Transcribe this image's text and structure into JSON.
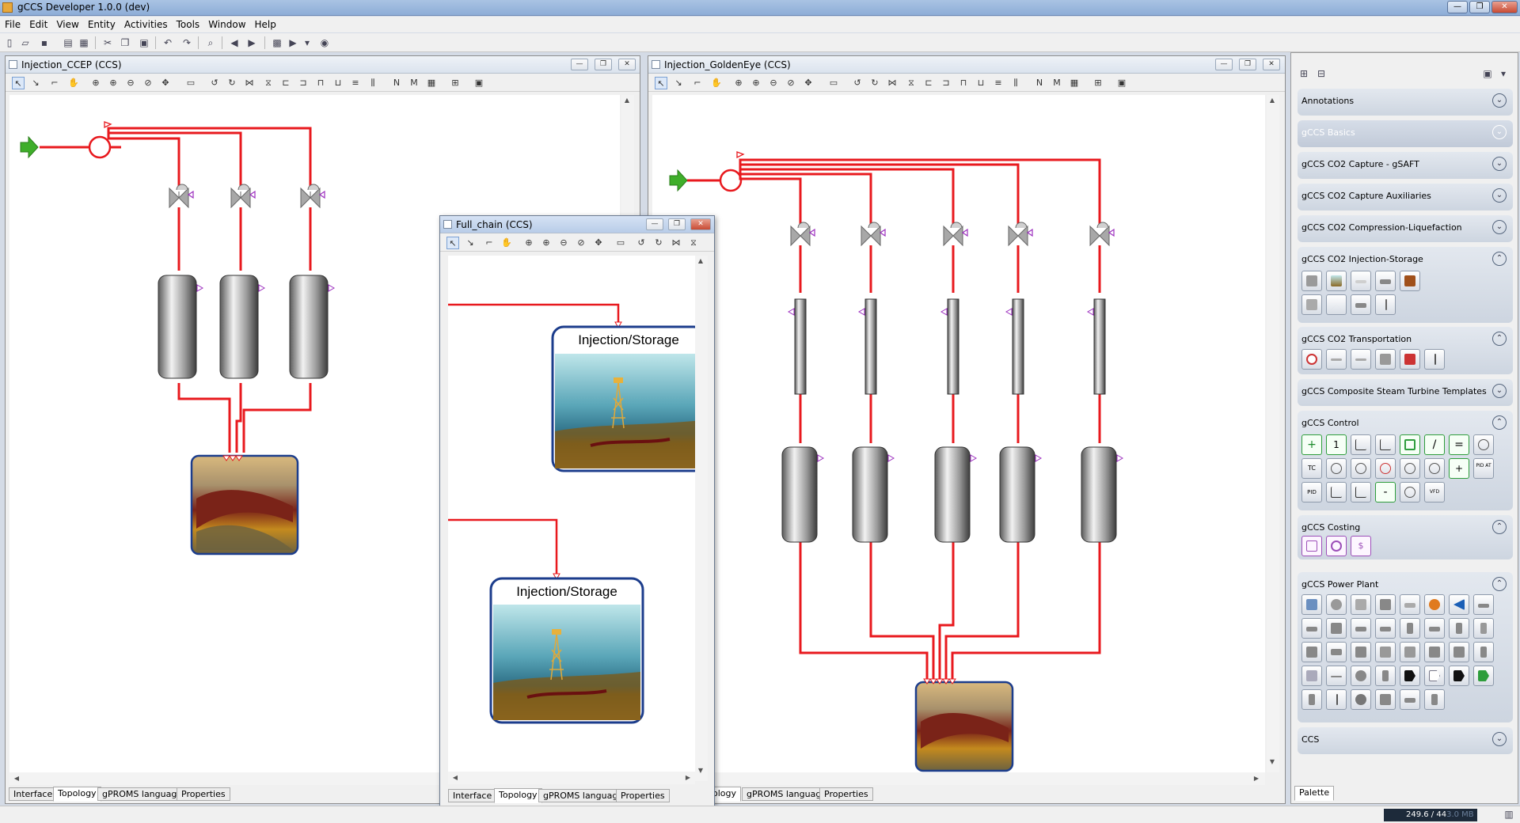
{
  "app": {
    "title": "gCCS Developer 1.0.0 (dev)"
  },
  "menu": [
    "File",
    "Edit",
    "View",
    "Entity",
    "Activities",
    "Tools",
    "Window",
    "Help"
  ],
  "windows": {
    "ccep": {
      "title": "Injection_CCEP  (CCS)"
    },
    "goldeneye": {
      "title": "Injection_GoldenEye  (CCS)"
    },
    "full_chain": {
      "title": "Full_chain  (CCS)"
    }
  },
  "bottom_tabs": [
    "Interface",
    "Topology",
    "gPROMS language",
    "Properties"
  ],
  "goldeneye_tab_partial": "ology",
  "active_tab": "Topology",
  "diagram_labels": {
    "storage_block": "Injection/Storage"
  },
  "palette": {
    "title": "Palette",
    "sections": [
      {
        "label": "Annotations",
        "expanded": false
      },
      {
        "label": "gCCS Basics",
        "expanded": false,
        "faded": true
      },
      {
        "label": "gCCS CO2 Capture - gSAFT",
        "expanded": false
      },
      {
        "label": "gCCS CO2 Capture Auxiliaries",
        "expanded": false
      },
      {
        "label": "gCCS CO2 Compression-Liquefaction",
        "expanded": false
      },
      {
        "label": "gCCS CO2 Injection-Storage",
        "expanded": true
      },
      {
        "label": "gCCS CO2 Transportation",
        "expanded": true
      },
      {
        "label": "gCCS Composite Steam Turbine Templates",
        "expanded": false
      },
      {
        "label": "gCCS Control",
        "expanded": true
      },
      {
        "label": "gCCS Costing",
        "expanded": true
      },
      {
        "label": "gCCS Power Plant",
        "expanded": true
      },
      {
        "label": "CCS",
        "expanded": false
      }
    ],
    "control_icon_text": [
      "+",
      "1",
      "",
      "",
      "",
      "/",
      "=",
      "",
      "TC",
      "",
      "",
      "",
      "",
      "",
      "+",
      "PID AT",
      "PID",
      "",
      "",
      "-",
      "",
      "VFD"
    ],
    "costing_icon_text": [
      "",
      "",
      "$"
    ]
  },
  "status": {
    "memory": "249.6 / 44",
    "memory_tail": "3.0 MB"
  },
  "colors": {
    "stream": "#e8191e",
    "frame_blue": "#1c3d8c",
    "inlet_green": "#3fae2a"
  }
}
